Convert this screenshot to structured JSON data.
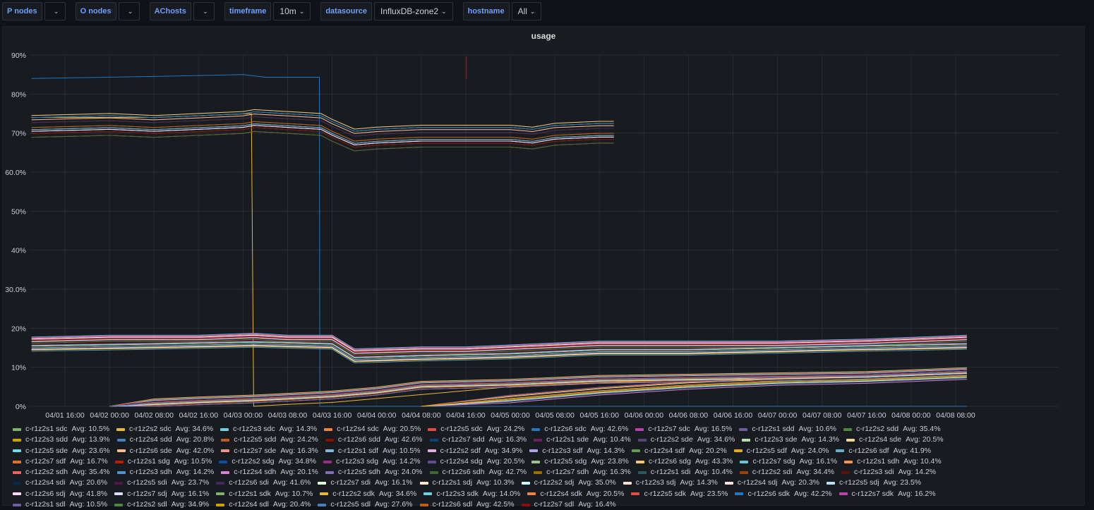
{
  "variables": [
    {
      "label": "P nodes",
      "value": ""
    },
    {
      "label": "O nodes",
      "value": ""
    },
    {
      "label": "AChosts",
      "value": ""
    },
    {
      "label": "timeframe",
      "value": "10m"
    },
    {
      "label": "datasource",
      "value": "InfluxDB-zone2"
    },
    {
      "label": "hostname",
      "value": "All"
    }
  ],
  "panel": {
    "title": "usage"
  },
  "chart_data": {
    "type": "line",
    "title": "usage",
    "x_unit": "hours since 04/01 16:00",
    "x_range": [
      -6.3,
      165
    ],
    "ylim": [
      0,
      90
    ],
    "grid": true,
    "legend_placement": "bottom",
    "y_ticks": [
      {
        "v": 0,
        "label": "0%"
      },
      {
        "v": 10,
        "label": "10%"
      },
      {
        "v": 20,
        "label": "20%"
      },
      {
        "v": 30,
        "label": "30.0%"
      },
      {
        "v": 40,
        "label": "40%"
      },
      {
        "v": 50,
        "label": "50%"
      },
      {
        "v": 60,
        "label": "60.0%"
      },
      {
        "v": 70,
        "label": "70%"
      },
      {
        "v": 80,
        "label": "80%"
      },
      {
        "v": 90,
        "label": "90%"
      }
    ],
    "x_ticks": [
      "04/01 16:00",
      "04/02 00:00",
      "04/02 08:00",
      "04/02 16:00",
      "04/03 00:00",
      "04/03 08:00",
      "04/03 16:00",
      "04/04 00:00",
      "04/04 08:00",
      "04/04 16:00",
      "04/05 00:00",
      "04/05 08:00",
      "04/05 16:00",
      "04/06 00:00",
      "04/06 08:00",
      "04/06 16:00",
      "04/07 00:00",
      "04/07 08:00",
      "04/07 16:00",
      "04/08 00:00",
      "04/08 08:00"
    ],
    "x_tick_step_hours": 8,
    "profiles": {
      "high": [
        [
          -6,
          72
        ],
        [
          8,
          72.5
        ],
        [
          16,
          72
        ],
        [
          24,
          72.5
        ],
        [
          32,
          73
        ],
        [
          34,
          73.5
        ],
        [
          40,
          73
        ],
        [
          46,
          72.5
        ],
        [
          48,
          71
        ],
        [
          52,
          68.5
        ],
        [
          56,
          69
        ],
        [
          64,
          69.5
        ],
        [
          72,
          69.5
        ],
        [
          80,
          69.5
        ],
        [
          84,
          69
        ],
        [
          88,
          70
        ],
        [
          96,
          70.5
        ],
        [
          98.6,
          70.5
        ]
      ],
      "drop_a": [
        [
          -6,
          74
        ],
        [
          16,
          74
        ],
        [
          33.5,
          75
        ],
        [
          33.9,
          0
        ],
        [
          40,
          0.5
        ],
        [
          48,
          1
        ],
        [
          64,
          3
        ],
        [
          80,
          5
        ],
        [
          96,
          6
        ],
        [
          120,
          7
        ],
        [
          144,
          8
        ],
        [
          162,
          9
        ]
      ],
      "drop_b": [
        [
          -6,
          84
        ],
        [
          16,
          84.5
        ],
        [
          32,
          85
        ],
        [
          36,
          84.3
        ],
        [
          45.7,
          84.3
        ],
        [
          45.8,
          0
        ],
        [
          162,
          0
        ]
      ],
      "mid_hi": [
        [
          -6,
          17
        ],
        [
          8,
          17.5
        ],
        [
          16,
          17.5
        ],
        [
          24,
          17.5
        ],
        [
          34,
          18
        ],
        [
          40,
          17.5
        ],
        [
          48,
          17.5
        ],
        [
          52,
          14
        ],
        [
          64,
          14.5
        ],
        [
          72,
          14.5
        ],
        [
          80,
          15
        ],
        [
          96,
          16
        ],
        [
          112,
          16
        ],
        [
          128,
          16
        ],
        [
          144,
          16.5
        ],
        [
          162,
          17.5
        ]
      ],
      "mid_lo": [
        [
          -6,
          15
        ],
        [
          16,
          15.5
        ],
        [
          34,
          16
        ],
        [
          48,
          15.5
        ],
        [
          52,
          12
        ],
        [
          64,
          12.5
        ],
        [
          80,
          13
        ],
        [
          96,
          14
        ],
        [
          112,
          14
        ],
        [
          128,
          14.5
        ],
        [
          144,
          15
        ],
        [
          162,
          15.5
        ]
      ],
      "low": [
        [
          8,
          0
        ],
        [
          16,
          1
        ],
        [
          24,
          1.5
        ],
        [
          34,
          2
        ],
        [
          48,
          3
        ],
        [
          56,
          4
        ],
        [
          64,
          5.5
        ],
        [
          80,
          6
        ],
        [
          96,
          7
        ],
        [
          120,
          7.5
        ],
        [
          144,
          8
        ],
        [
          162,
          9
        ]
      ],
      "low_late": [
        [
          64,
          0
        ],
        [
          80,
          2
        ],
        [
          96,
          4
        ],
        [
          112,
          5.5
        ],
        [
          128,
          6.5
        ],
        [
          144,
          7
        ],
        [
          162,
          8
        ]
      ]
    },
    "host_profile": {
      "c-r1z2s1": "low",
      "c-r1z2s2": "high",
      "c-r1z2s3": "mid_lo",
      "c-r1z2s4": "low_late",
      "c-r1z2s5": "low",
      "c-r1z2s6": "high",
      "c-r1z2s7": "mid_hi"
    },
    "disk_offset": {
      "sdc": 0,
      "sdd": -1.5,
      "sde": 1,
      "sdf": -0.8,
      "sdg": 1.8,
      "sdh": -2.2,
      "sdi": 0.5,
      "sdj": -1.1,
      "sdk": 1.4,
      "sdl": -0.4
    },
    "series_overrides": {
      "c-r1z2s2 sdc": "drop_a",
      "c-r1z2s6 sdc": "drop_b"
    },
    "series": [
      {
        "name": "c-r1z2s1 sdc",
        "avg": "10.5%",
        "color": "#7EB26D"
      },
      {
        "name": "c-r1z2s2 sdc",
        "avg": "34.6%",
        "color": "#EAB839"
      },
      {
        "name": "c-r1z2s3 sdc",
        "avg": "14.3%",
        "color": "#6ED0E0"
      },
      {
        "name": "c-r1z2s4 sdc",
        "avg": "20.5%",
        "color": "#EF843C"
      },
      {
        "name": "c-r1z2s5 sdc",
        "avg": "24.2%",
        "color": "#E24D42"
      },
      {
        "name": "c-r1z2s6 sdc",
        "avg": "42.6%",
        "color": "#1F78C1"
      },
      {
        "name": "c-r1z2s7 sdc",
        "avg": "16.5%",
        "color": "#BA43A9"
      },
      {
        "name": "c-r1z2s1 sdd",
        "avg": "10.6%",
        "color": "#705DA0"
      },
      {
        "name": "c-r1z2s2 sdd",
        "avg": "35.4%",
        "color": "#508642"
      },
      {
        "name": "c-r1z2s3 sdd",
        "avg": "13.9%",
        "color": "#CCA300"
      },
      {
        "name": "c-r1z2s4 sdd",
        "avg": "20.8%",
        "color": "#447EBC"
      },
      {
        "name": "c-r1z2s5 sdd",
        "avg": "24.2%",
        "color": "#C15C17"
      },
      {
        "name": "c-r1z2s6 sdd",
        "avg": "42.6%",
        "color": "#890F02"
      },
      {
        "name": "c-r1z2s7 sdd",
        "avg": "16.3%",
        "color": "#0A437C"
      },
      {
        "name": "c-r1z2s1 sde",
        "avg": "10.4%",
        "color": "#6D1F62"
      },
      {
        "name": "c-r1z2s2 sde",
        "avg": "34.6%",
        "color": "#584477"
      },
      {
        "name": "c-r1z2s3 sde",
        "avg": "14.3%",
        "color": "#B7DBAB"
      },
      {
        "name": "c-r1z2s4 sde",
        "avg": "20.5%",
        "color": "#F4D598"
      },
      {
        "name": "c-r1z2s5 sde",
        "avg": "23.6%",
        "color": "#70DBED"
      },
      {
        "name": "c-r1z2s6 sde",
        "avg": "42.0%",
        "color": "#F9BA8F"
      },
      {
        "name": "c-r1z2s7 sde",
        "avg": "16.3%",
        "color": "#F29191"
      },
      {
        "name": "c-r1z2s1 sdf",
        "avg": "10.5%",
        "color": "#82B5D8"
      },
      {
        "name": "c-r1z2s2 sdf",
        "avg": "34.9%",
        "color": "#E5A8E2"
      },
      {
        "name": "c-r1z2s3 sdf",
        "avg": "14.3%",
        "color": "#AEA2E0"
      },
      {
        "name": "c-r1z2s4 sdf",
        "avg": "20.2%",
        "color": "#629E51"
      },
      {
        "name": "c-r1z2s5 sdf",
        "avg": "24.0%",
        "color": "#E5AC0E"
      },
      {
        "name": "c-r1z2s6 sdf",
        "avg": "41.9%",
        "color": "#64B0C8"
      },
      {
        "name": "c-r1z2s7 sdf",
        "avg": "16.7%",
        "color": "#E0752D"
      },
      {
        "name": "c-r1z2s1 sdg",
        "avg": "10.5%",
        "color": "#BF1B00"
      },
      {
        "name": "c-r1z2s2 sdg",
        "avg": "34.8%",
        "color": "#0A50A1"
      },
      {
        "name": "c-r1z2s3 sdg",
        "avg": "14.2%",
        "color": "#962D82"
      },
      {
        "name": "c-r1z2s4 sdg",
        "avg": "20.5%",
        "color": "#614D93"
      },
      {
        "name": "c-r1z2s5 sdg",
        "avg": "23.8%",
        "color": "#9AC48A"
      },
      {
        "name": "c-r1z2s6 sdg",
        "avg": "43.3%",
        "color": "#F2C96D"
      },
      {
        "name": "c-r1z2s7 sdg",
        "avg": "16.1%",
        "color": "#65C5DB"
      },
      {
        "name": "c-r1z2s1 sdh",
        "avg": "10.4%",
        "color": "#F9934E"
      },
      {
        "name": "c-r1z2s2 sdh",
        "avg": "35.4%",
        "color": "#EA6460"
      },
      {
        "name": "c-r1z2s3 sdh",
        "avg": "14.2%",
        "color": "#5195CE"
      },
      {
        "name": "c-r1z2s4 sdh",
        "avg": "20.1%",
        "color": "#D683CE"
      },
      {
        "name": "c-r1z2s5 sdh",
        "avg": "24.0%",
        "color": "#806EB7"
      },
      {
        "name": "c-r1z2s6 sdh",
        "avg": "42.7%",
        "color": "#3F6833"
      },
      {
        "name": "c-r1z2s7 sdh",
        "avg": "16.3%",
        "color": "#967302"
      },
      {
        "name": "c-r1z2s1 sdi",
        "avg": "10.4%",
        "color": "#2F575E"
      },
      {
        "name": "c-r1z2s2 sdi",
        "avg": "34.4%",
        "color": "#99440A"
      },
      {
        "name": "c-r1z2s3 sdi",
        "avg": "14.2%",
        "color": "#58140C"
      },
      {
        "name": "c-r1z2s4 sdi",
        "avg": "20.6%",
        "color": "#052B51"
      },
      {
        "name": "c-r1z2s5 sdi",
        "avg": "23.7%",
        "color": "#511749"
      },
      {
        "name": "c-r1z2s6 sdi",
        "avg": "41.6%",
        "color": "#3F2B5B"
      },
      {
        "name": "c-r1z2s7 sdi",
        "avg": "16.1%",
        "color": "#E0F9D7"
      },
      {
        "name": "c-r1z2s1 sdj",
        "avg": "10.3%",
        "color": "#FCEACA"
      },
      {
        "name": "c-r1z2s2 sdj",
        "avg": "35.0%",
        "color": "#CFFAFF"
      },
      {
        "name": "c-r1z2s3 sdj",
        "avg": "14.3%",
        "color": "#F9E2D2"
      },
      {
        "name": "c-r1z2s4 sdj",
        "avg": "20.3%",
        "color": "#FCE2DE"
      },
      {
        "name": "c-r1z2s5 sdj",
        "avg": "23.5%",
        "color": "#BADFF4"
      },
      {
        "name": "c-r1z2s6 sdj",
        "avg": "41.8%",
        "color": "#F9D9F9"
      },
      {
        "name": "c-r1z2s7 sdj",
        "avg": "16.1%",
        "color": "#DEDAF7"
      },
      {
        "name": "c-r1z2s1 sdk",
        "avg": "10.7%",
        "color": "#7EB26D"
      },
      {
        "name": "c-r1z2s2 sdk",
        "avg": "34.6%",
        "color": "#EAB839"
      },
      {
        "name": "c-r1z2s3 sdk",
        "avg": "14.0%",
        "color": "#6ED0E0"
      },
      {
        "name": "c-r1z2s4 sdk",
        "avg": "20.5%",
        "color": "#EF843C"
      },
      {
        "name": "c-r1z2s5 sdk",
        "avg": "23.5%",
        "color": "#E24D42"
      },
      {
        "name": "c-r1z2s6 sdk",
        "avg": "42.2%",
        "color": "#1F78C1"
      },
      {
        "name": "c-r1z2s7 sdk",
        "avg": "16.2%",
        "color": "#BA43A9"
      },
      {
        "name": "c-r1z2s1 sdl",
        "avg": "10.5%",
        "color": "#705DA0"
      },
      {
        "name": "c-r1z2s2 sdl",
        "avg": "34.9%",
        "color": "#508642"
      },
      {
        "name": "c-r1z2s4 sdl",
        "avg": "20.4%",
        "color": "#CCA300"
      },
      {
        "name": "c-r1z2s5 sdl",
        "avg": "27.6%",
        "color": "#447EBC"
      },
      {
        "name": "c-r1z2s6 sdl",
        "avg": "42.5%",
        "color": "#C15C17"
      },
      {
        "name": "c-r1z2s7 sdl",
        "avg": "16.4%",
        "color": "#890F02"
      }
    ]
  }
}
